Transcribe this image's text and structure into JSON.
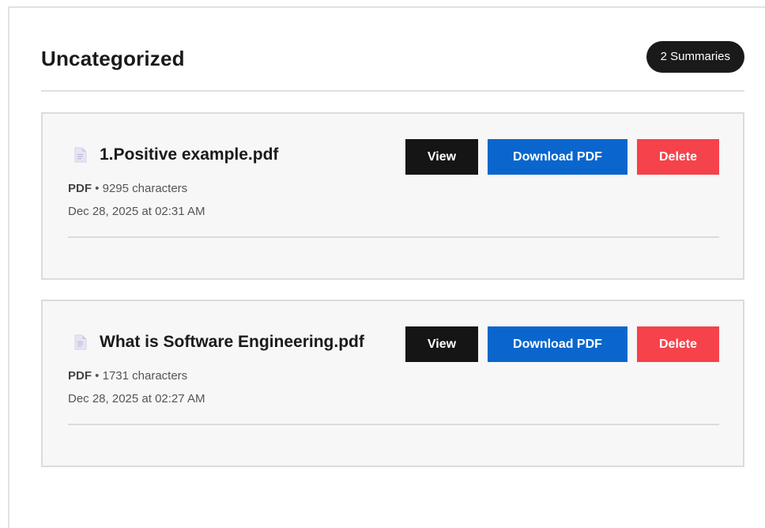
{
  "section": {
    "title": "Uncategorized",
    "badge": "2 Summaries"
  },
  "summaries": [
    {
      "file_name": "1.Positive example.pdf",
      "type": "PDF",
      "separator": "•",
      "characters": "9295 characters",
      "date": "Dec 28, 2025 at 02:31 AM",
      "icon": "document-icon"
    },
    {
      "file_name": "What is Software Engineering.pdf",
      "type": "PDF",
      "separator": "•",
      "characters": "1731 characters",
      "date": "Dec 28, 2025 at 02:27 AM",
      "icon": "document-icon"
    }
  ],
  "actions": {
    "view_label": "View",
    "download_label": "Download PDF",
    "delete_label": "Delete"
  },
  "colors": {
    "view": "#151515",
    "download": "#0a66cc",
    "delete": "#f5424b",
    "badge": "#1a1a1a",
    "card_bg": "#f7f7f7"
  }
}
